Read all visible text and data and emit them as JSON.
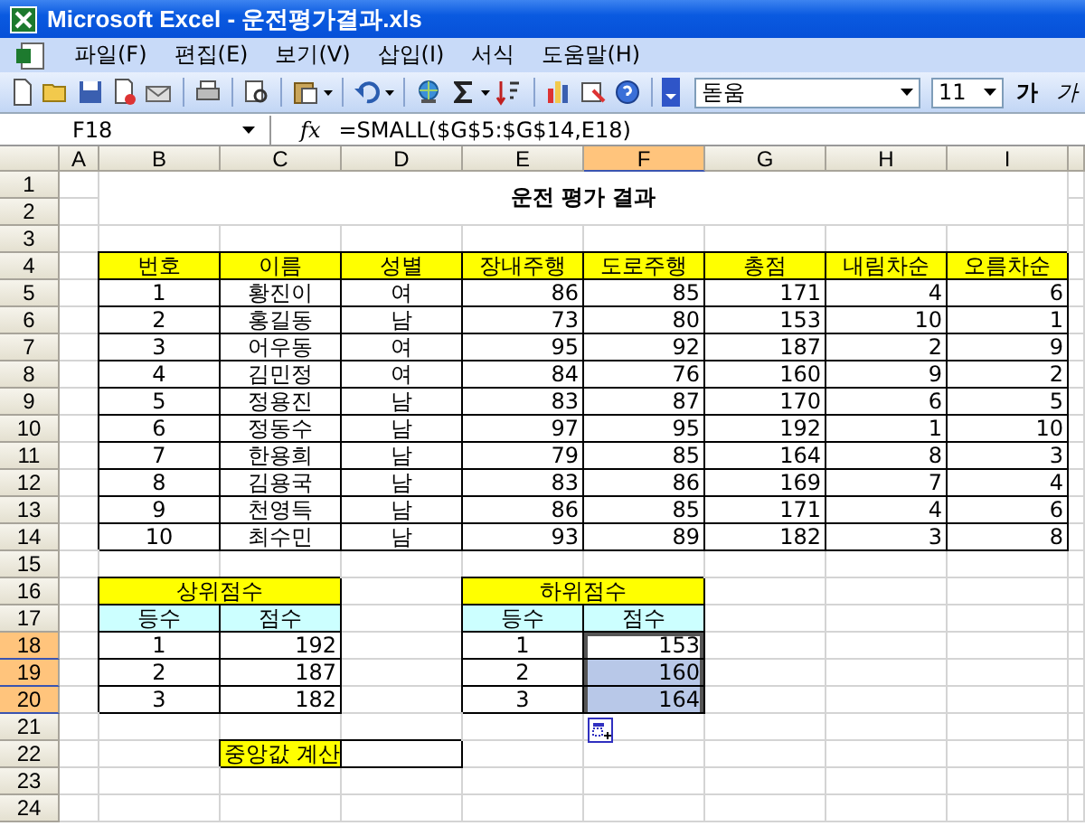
{
  "window": {
    "title": "Microsoft Excel - 운전평가결과.xls"
  },
  "menu": [
    {
      "label": "파일(F)"
    },
    {
      "label": "편집(E)"
    },
    {
      "label": "보기(V)"
    },
    {
      "label": "삽입(I)"
    },
    {
      "label": "서식"
    },
    {
      "label": "도움말(H)"
    }
  ],
  "toolbar": {
    "font_name": "돋움",
    "font_size": "11",
    "bold_label": "가",
    "italic_label": "가"
  },
  "formula_bar": {
    "name_box": "F18",
    "fx_label": "fx",
    "formula": "=SMALL($G$5:$G$14,E18)"
  },
  "sheet": {
    "column_headers": [
      {
        "label": "A",
        "selected": false
      },
      {
        "label": "B",
        "selected": false
      },
      {
        "label": "C",
        "selected": false
      },
      {
        "label": "D",
        "selected": false
      },
      {
        "label": "E",
        "selected": false
      },
      {
        "label": "F",
        "selected": true
      },
      {
        "label": "G",
        "selected": false
      },
      {
        "label": "H",
        "selected": false
      },
      {
        "label": "I",
        "selected": false
      }
    ],
    "row_headers": [
      {
        "label": "1",
        "selected": false
      },
      {
        "label": "2",
        "selected": false
      },
      {
        "label": "3",
        "selected": false
      },
      {
        "label": "4",
        "selected": false
      },
      {
        "label": "5",
        "selected": false
      },
      {
        "label": "6",
        "selected": false
      },
      {
        "label": "7",
        "selected": false
      },
      {
        "label": "8",
        "selected": false
      },
      {
        "label": "9",
        "selected": false
      },
      {
        "label": "10",
        "selected": false
      },
      {
        "label": "11",
        "selected": false
      },
      {
        "label": "12",
        "selected": false
      },
      {
        "label": "13",
        "selected": false
      },
      {
        "label": "14",
        "selected": false
      },
      {
        "label": "15",
        "selected": false
      },
      {
        "label": "16",
        "selected": false
      },
      {
        "label": "17",
        "selected": false
      },
      {
        "label": "18",
        "selected": true
      },
      {
        "label": "19",
        "selected": true
      },
      {
        "label": "20",
        "selected": true
      },
      {
        "label": "21",
        "selected": false
      },
      {
        "label": "22",
        "selected": false
      },
      {
        "label": "23",
        "selected": false
      },
      {
        "label": "24",
        "selected": false
      }
    ],
    "title": "운전 평가 결과",
    "table": {
      "columns": [
        "번호",
        "이름",
        "성별",
        "장내주행",
        "도로주행",
        "총점",
        "내림차순",
        "오름차순"
      ],
      "rows": [
        [
          "1",
          "황진이",
          "여",
          "86",
          "85",
          "171",
          "4",
          "6"
        ],
        [
          "2",
          "홍길동",
          "남",
          "73",
          "80",
          "153",
          "10",
          "1"
        ],
        [
          "3",
          "어우동",
          "여",
          "95",
          "92",
          "187",
          "2",
          "9"
        ],
        [
          "4",
          "김민정",
          "여",
          "84",
          "76",
          "160",
          "9",
          "2"
        ],
        [
          "5",
          "정용진",
          "남",
          "83",
          "87",
          "170",
          "6",
          "5"
        ],
        [
          "6",
          "정동수",
          "남",
          "97",
          "95",
          "192",
          "1",
          "10"
        ],
        [
          "7",
          "한용희",
          "남",
          "79",
          "85",
          "164",
          "8",
          "3"
        ],
        [
          "8",
          "김용국",
          "남",
          "83",
          "86",
          "169",
          "7",
          "4"
        ],
        [
          "9",
          "천영득",
          "남",
          "86",
          "85",
          "171",
          "4",
          "6"
        ],
        [
          "10",
          "최수민",
          "남",
          "93",
          "89",
          "182",
          "3",
          "8"
        ]
      ]
    },
    "top_scores": {
      "title": "상위점수",
      "columns": [
        "등수",
        "점수"
      ],
      "rows": [
        {
          "rank": "1",
          "score": "192",
          "selected": false,
          "active": false
        },
        {
          "rank": "2",
          "score": "187",
          "selected": false,
          "active": false
        },
        {
          "rank": "3",
          "score": "182",
          "selected": false,
          "active": false
        }
      ]
    },
    "bottom_scores": {
      "title": "하위점수",
      "columns": [
        "등수",
        "점수"
      ],
      "rows": [
        {
          "rank": "1",
          "score": "153",
          "selected": true,
          "active": true
        },
        {
          "rank": "2",
          "score": "160",
          "selected": true,
          "active": false
        },
        {
          "rank": "3",
          "score": "164",
          "selected": true,
          "active": false
        }
      ]
    },
    "median": {
      "label": "중앙값 계산"
    }
  }
}
